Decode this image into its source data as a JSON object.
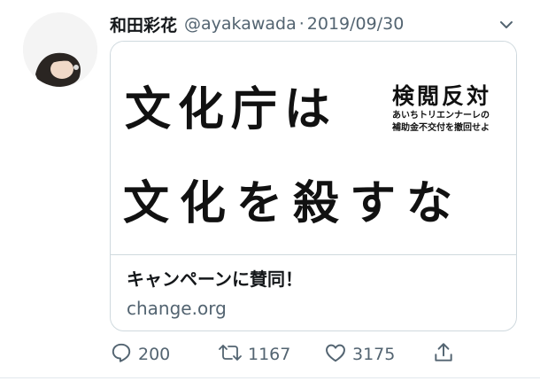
{
  "tweet": {
    "author_name": "和田彩花",
    "handle": "@ayakawada",
    "separator": "·",
    "date": "2019/09/30"
  },
  "card": {
    "image_text": {
      "line1": "文化庁は",
      "line2": "文化を殺すな",
      "heading": "検閲反対",
      "sub1": "あいちトリエンナーレの",
      "sub2": "補助金不交付を撤回せよ"
    },
    "title": "キャンペーンに賛同！",
    "domain": "change.org"
  },
  "actions": {
    "replies": "200",
    "retweets": "1167",
    "likes": "3175"
  },
  "icons": {
    "caret": "chevron-down-icon",
    "reply": "reply-icon",
    "retweet": "retweet-icon",
    "like": "heart-icon",
    "share": "share-icon"
  },
  "colors": {
    "text_primary": "#14171a",
    "text_secondary": "#536471",
    "border": "#cfd9de"
  }
}
